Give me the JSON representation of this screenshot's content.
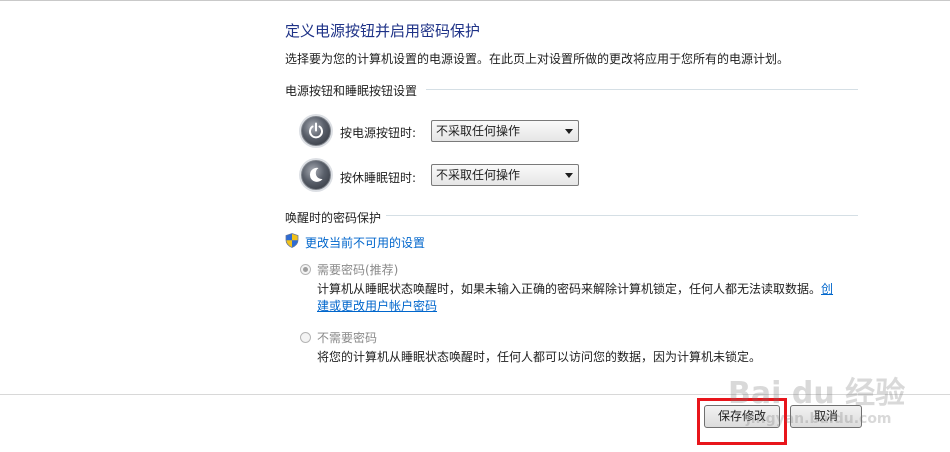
{
  "header": {
    "title": "定义电源按钮并启用密码保护",
    "description": "选择要为您的计算机设置的电源设置。在此页上对设置所做的更改将应用于您所有的电源计划。"
  },
  "power_section": {
    "heading": "电源按钮和睡眠按钮设置",
    "power_button": {
      "label": "按电源按钮时:",
      "value": "不采取任何操作",
      "icon": "power-icon"
    },
    "sleep_button": {
      "label": "按休睡眠钮时:",
      "value": "不采取任何操作",
      "icon": "sleep-icon"
    }
  },
  "password_section": {
    "heading": "唤醒时的密码保护",
    "change_link": "更改当前不可用的设置",
    "option_require": {
      "label": "需要密码(推荐)",
      "desc_text": "计算机从睡眠状态唤醒时，如果未输入正确的密码来解除计算机锁定，任何人都无法读取数据。",
      "desc_link_part1": "创",
      "desc_link_part2": "建或更改用户帐户密码",
      "selected": true
    },
    "option_no_require": {
      "label": "不需要密码",
      "desc": "将您的计算机从睡眠状态唤醒时，任何人都可以访问您的数据，因为计算机未锁定。",
      "selected": false
    }
  },
  "footer": {
    "save_label": "保存修改",
    "cancel_label": "取消"
  },
  "watermark": {
    "brand": "Bai du 经验",
    "url": "jingyan.baidu.com"
  },
  "colors": {
    "title": "#1e3287",
    "link": "#0066cc",
    "highlight": "#e8151b"
  }
}
